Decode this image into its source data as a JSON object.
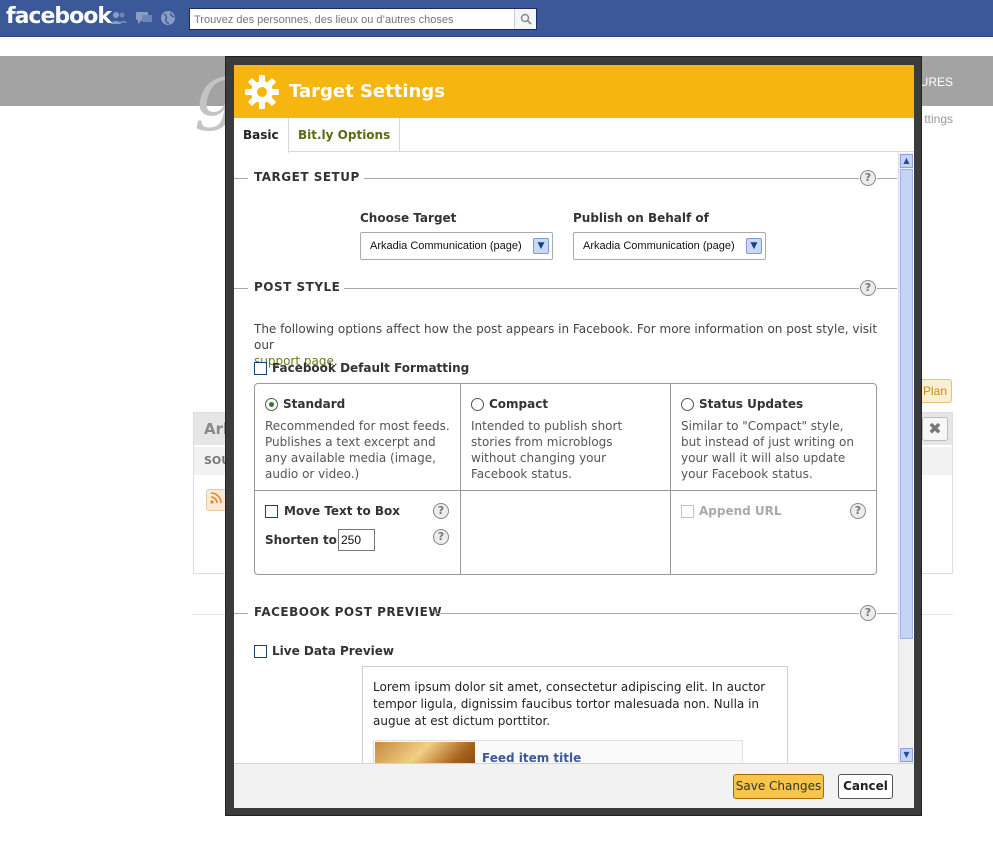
{
  "facebook": {
    "logo": "facebook",
    "search_placeholder": "Trouvez des personnes, des lieux ou d’autres choses",
    "icons": [
      "friends-icon",
      "messages-icon",
      "globe-icon",
      "search-icon"
    ]
  },
  "background": {
    "nav_right": "TURES",
    "settings_link": "ttings",
    "plan_button": "Plan",
    "panel_title": "Ark",
    "panel_source_label": "SOU",
    "close_glyph": "✖"
  },
  "modal": {
    "title": "Target Settings",
    "tabs": [
      {
        "label": "Basic",
        "active": true
      },
      {
        "label": "Bit.ly Options",
        "active": false
      }
    ],
    "target_setup": {
      "heading": "TARGET SETUP",
      "choose_target_label": "Choose Target",
      "choose_target_value": "Arkadia Communication (page)",
      "publish_label": "Publish on Behalf of",
      "publish_value": "Arkadia Communication (page)"
    },
    "post_style": {
      "heading": "POST STYLE",
      "intro": "The following options affect how the post appears in Facebook. For more information on post style, visit our",
      "intro_link": "support page",
      "intro_end": ".",
      "default_formatting_label": "Facebook Default Formatting",
      "options": [
        {
          "label": "Standard",
          "checked": true,
          "desc": "Recommended for most feeds. Publishes a text excerpt and any available media (image, audio or video.)"
        },
        {
          "label": "Compact",
          "checked": false,
          "desc": "Intended to publish short stories from microblogs without changing your Facebook status."
        },
        {
          "label": "Status Updates",
          "checked": false,
          "desc": "Similar to \"Compact\" style, but instead of just writing on your wall it will also update your Facebook status."
        }
      ],
      "move_text_label": "Move Text to Box",
      "shorten_label": "Shorten to",
      "shorten_value": "250",
      "append_url_label": "Append URL"
    },
    "preview": {
      "heading": "FACEBOOK POST PREVIEW",
      "live_label": "Live Data Preview",
      "text": "Lorem ipsum dolor sit amet, consectetur adipiscing elit. In auctor tempor ligula, dignissim faucibus tortor malesuada non. Nulla in augue at est dictum porttitor.",
      "feed_title": "Feed item title"
    },
    "footer": {
      "save_label": "Save Changes",
      "cancel_label": "Cancel"
    },
    "help_glyph": "?",
    "colors": {
      "header": "#f7b50f",
      "link": "#6b7a1a",
      "save_button": "#f9c44a"
    }
  }
}
